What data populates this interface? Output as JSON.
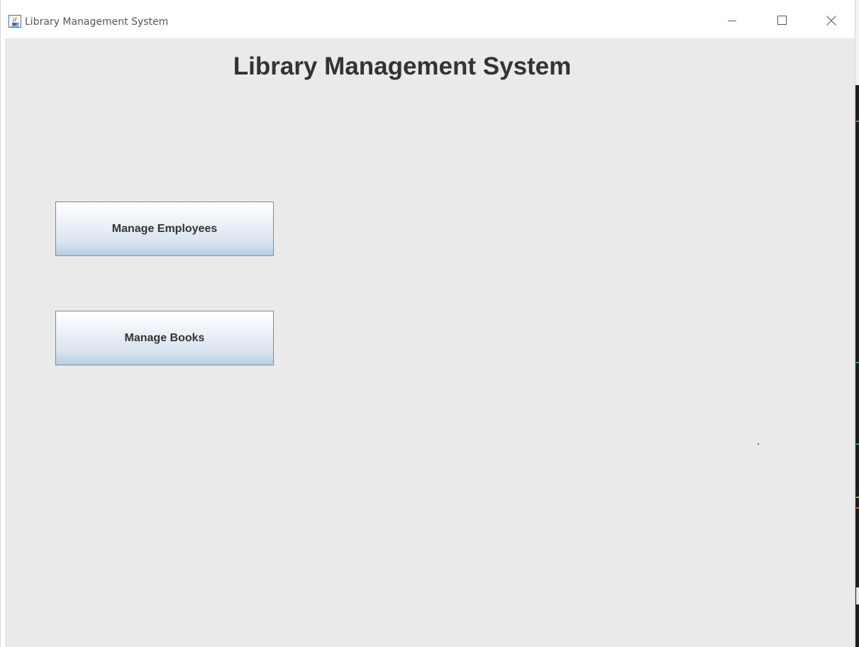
{
  "window": {
    "title": "Library Management System",
    "controls": {
      "minimize": "minimize-icon",
      "maximize": "maximize-icon",
      "close": "close-icon"
    },
    "app_icon": "java-cup-icon"
  },
  "main": {
    "heading": "Library Management System",
    "buttons": {
      "manage_employees": "Manage Employees",
      "manage_books": "Manage Books"
    }
  },
  "colors": {
    "content_background": "#eaeaea",
    "button_border": "#7a8a99",
    "button_gradient_bottom": "#b9cde2",
    "heading_text": "#333333"
  }
}
